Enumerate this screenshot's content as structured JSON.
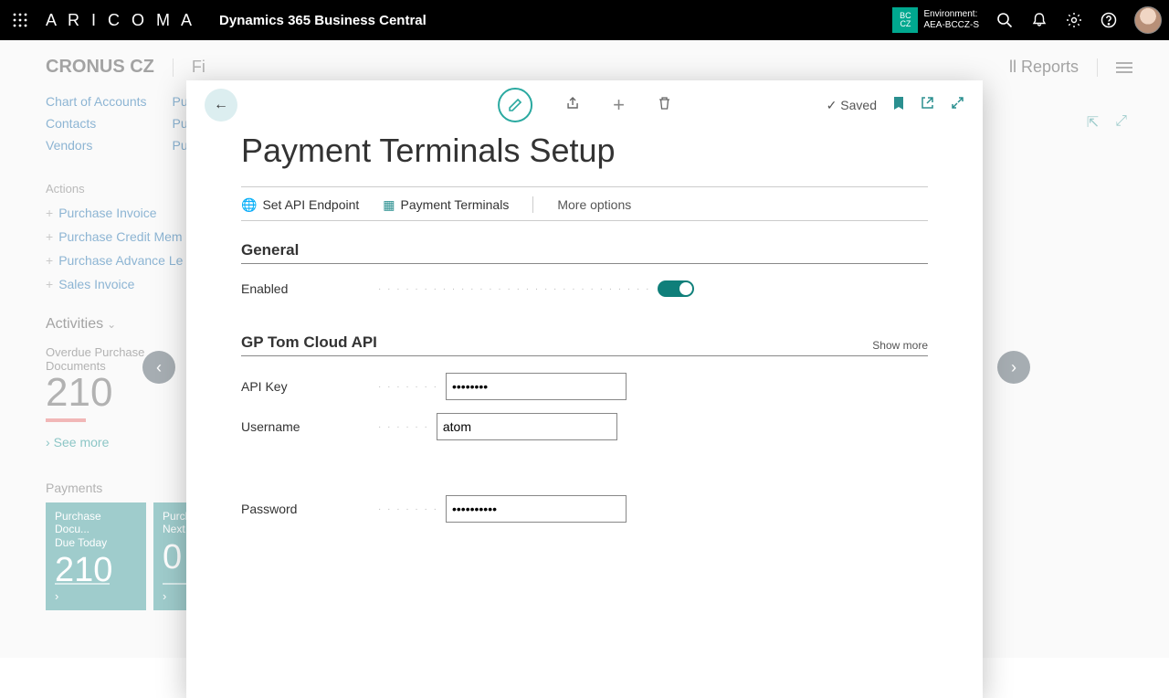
{
  "topbar": {
    "brand": "A R I C O M A",
    "app_title": "Dynamics 365 Business Central",
    "env_badge_top": "BC",
    "env_badge_bottom": "CZ",
    "env_label": "Environment:",
    "env_name": "AEA-BCCZ-S"
  },
  "page": {
    "company": "CRONUS CZ",
    "tab": "Fi",
    "right_link": "ll Reports",
    "nav_col1": [
      "Chart of Accounts",
      "Contacts",
      "Vendors"
    ],
    "nav_col2": [
      "Pur",
      "Pur",
      "Pur"
    ],
    "actions_header": "Actions",
    "actions": [
      "Purchase Invoice",
      "Purchase Credit Mem",
      "Purchase Advance Le",
      "Sales Invoice"
    ],
    "activities_header": "Activities",
    "kpi1_label_a": "Overdue Purchase",
    "kpi1_label_b": "Documents",
    "kpi1_value": "210",
    "see_more": "See more",
    "payments_header": "Payments",
    "tile1_label_a": "Purchase Docu...",
    "tile1_label_b": "Due Today",
    "tile1_value": "210",
    "tile2_label_a": "Purch",
    "tile2_label_b": "Next",
    "tile2_value": "0"
  },
  "modal": {
    "saved": "Saved",
    "title": "Payment Terminals Setup",
    "action1": "Set API Endpoint",
    "action2": "Payment Terminals",
    "more_options": "More options",
    "section_general": "General",
    "enabled_label": "Enabled",
    "section_api": "GP Tom Cloud API",
    "show_more": "Show more",
    "api_key_label": "API Key",
    "api_key_value": "••••••••",
    "password_label": "Password",
    "password_value": "••••••••••",
    "username_label": "Username",
    "username_value": "atom"
  }
}
